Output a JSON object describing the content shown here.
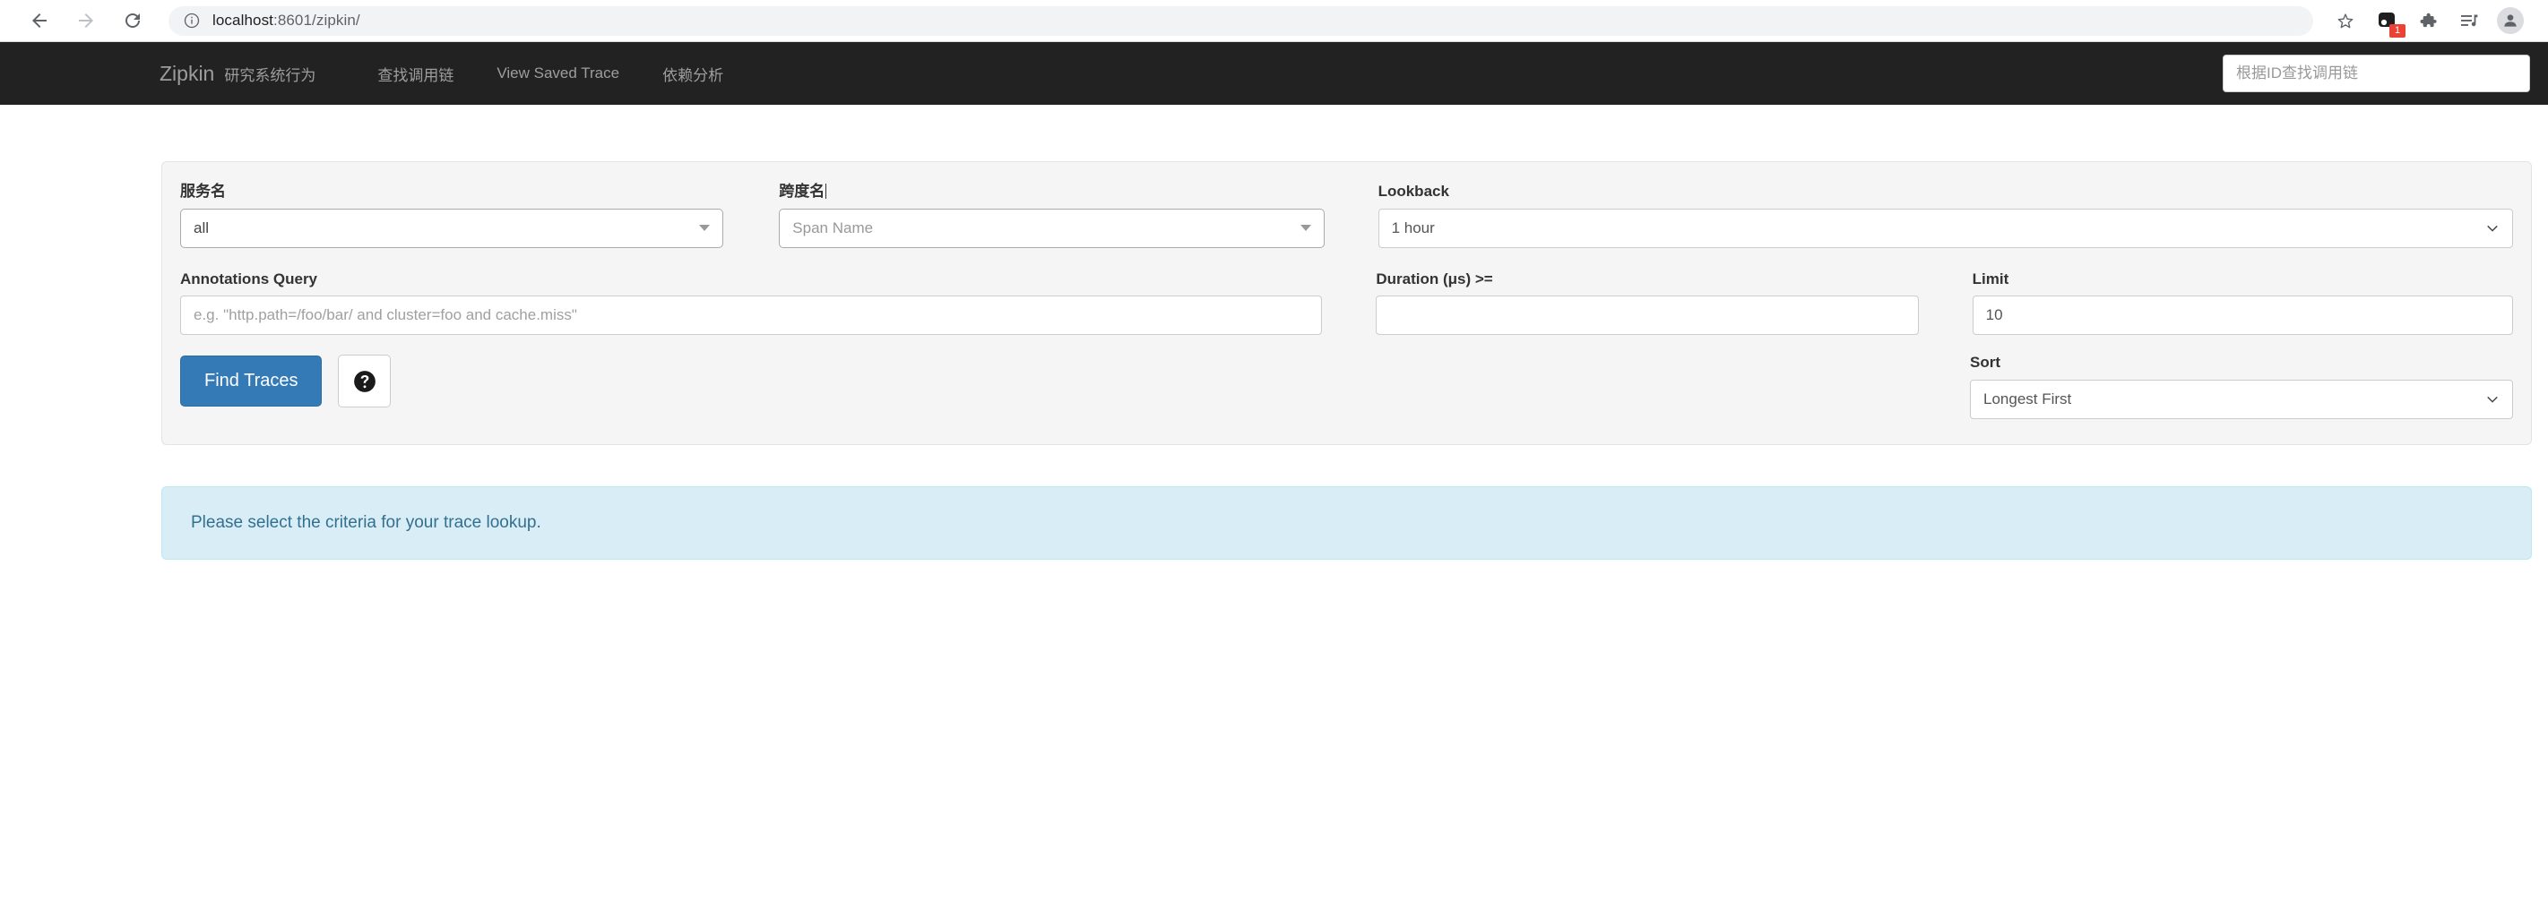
{
  "browser": {
    "back_icon": "arrow-left-icon",
    "forward_icon": "arrow-right-icon",
    "reload_icon": "reload-icon",
    "site_info_icon": "info-circle-icon",
    "url_host": "localhost",
    "url_rest": ":8601/zipkin/",
    "bookmark_icon": "star-icon",
    "extension_badge_count": "1",
    "extensions_icon": "puzzle-icon",
    "media_icon": "playlist-music-icon",
    "profile_icon": "avatar-icon"
  },
  "navbar": {
    "brand": "Zipkin",
    "brand_subtitle": "研究系统行为",
    "links": [
      {
        "label": "查找调用链"
      },
      {
        "label": "View Saved Trace"
      },
      {
        "label": "依赖分析"
      }
    ],
    "trace_search_placeholder": "根据ID查找调用链",
    "trace_search_value": "",
    "background_color": "#222222",
    "text_color": "#9d9d9d"
  },
  "form": {
    "service_name": {
      "label": "服务名",
      "value": "all"
    },
    "span_name": {
      "label": "跨度名",
      "placeholder": "Span Name",
      "value": ""
    },
    "lookback": {
      "label": "Lookback",
      "value": "1 hour"
    },
    "annotations_query": {
      "label": "Annotations Query",
      "placeholder": "e.g. \"http.path=/foo/bar/ and cluster=foo and cache.miss\"",
      "value": ""
    },
    "duration": {
      "label": "Duration (μs) >=",
      "value": ""
    },
    "limit": {
      "label": "Limit",
      "value": "10"
    },
    "sort": {
      "label": "Sort",
      "value": "Longest First"
    },
    "find_traces_label": "Find Traces",
    "help_icon": "question-mark-circle-icon",
    "primary_color": "#337ab7"
  },
  "alert": {
    "message": "Please select the criteria for your trace lookup.",
    "background_color": "#d9edf7",
    "text_color": "#31708f"
  }
}
